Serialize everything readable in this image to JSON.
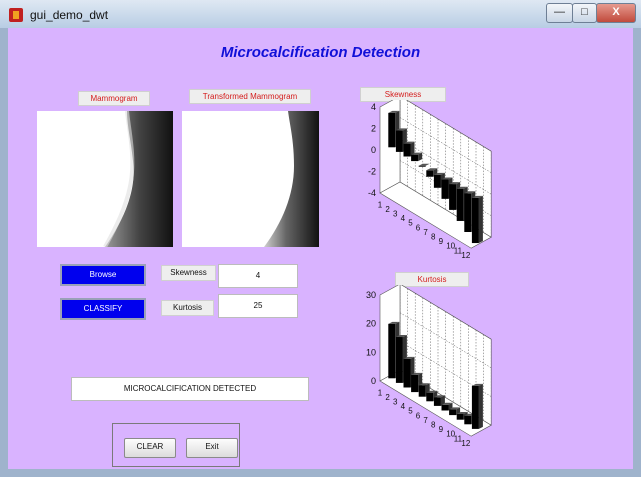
{
  "window": {
    "title": "gui_demo_dwt",
    "minimize_glyph": "—",
    "maximize_glyph": "□",
    "close_glyph": "X"
  },
  "app_title": "Microcalcification Detection",
  "images": {
    "mammogram_label": "Mammogram",
    "transformed_label": "Transformed Mammogram"
  },
  "controls": {
    "browse_label": "Browse",
    "classify_label": "CLASSIFY",
    "skewness_label": "Skewness",
    "skewness_value": "4",
    "kurtosis_label": "Kurtosis",
    "kurtosis_value": "25",
    "result_text": "MICROCALCIFICATION DETECTED",
    "clear_label": "CLEAR",
    "exit_label": "Exit"
  },
  "chart_data": [
    {
      "type": "bar3d",
      "title": "Skewness",
      "categories": [
        "1",
        "2",
        "3",
        "4",
        "5",
        "6",
        "7",
        "8",
        "9",
        "10",
        "11",
        "12"
      ],
      "values": [
        3.2,
        2.0,
        1.2,
        0.6,
        0.0,
        -0.6,
        -1.2,
        -1.8,
        -2.4,
        -3.0,
        -3.6,
        -4.2
      ],
      "yticks": [
        4,
        2,
        0,
        -2,
        -4
      ],
      "ylim": [
        -4,
        4
      ],
      "grid": true
    },
    {
      "type": "bar3d",
      "title": "Kurtosis",
      "categories": [
        "1",
        "2",
        "3",
        "4",
        "5",
        "6",
        "7",
        "8",
        "9",
        "10",
        "11",
        "12"
      ],
      "values": [
        19,
        16,
        10,
        6,
        4,
        3,
        3,
        2,
        2,
        2,
        3,
        15
      ],
      "yticks": [
        30,
        20,
        10,
        0
      ],
      "ylim": [
        0,
        30
      ],
      "grid": true
    }
  ]
}
